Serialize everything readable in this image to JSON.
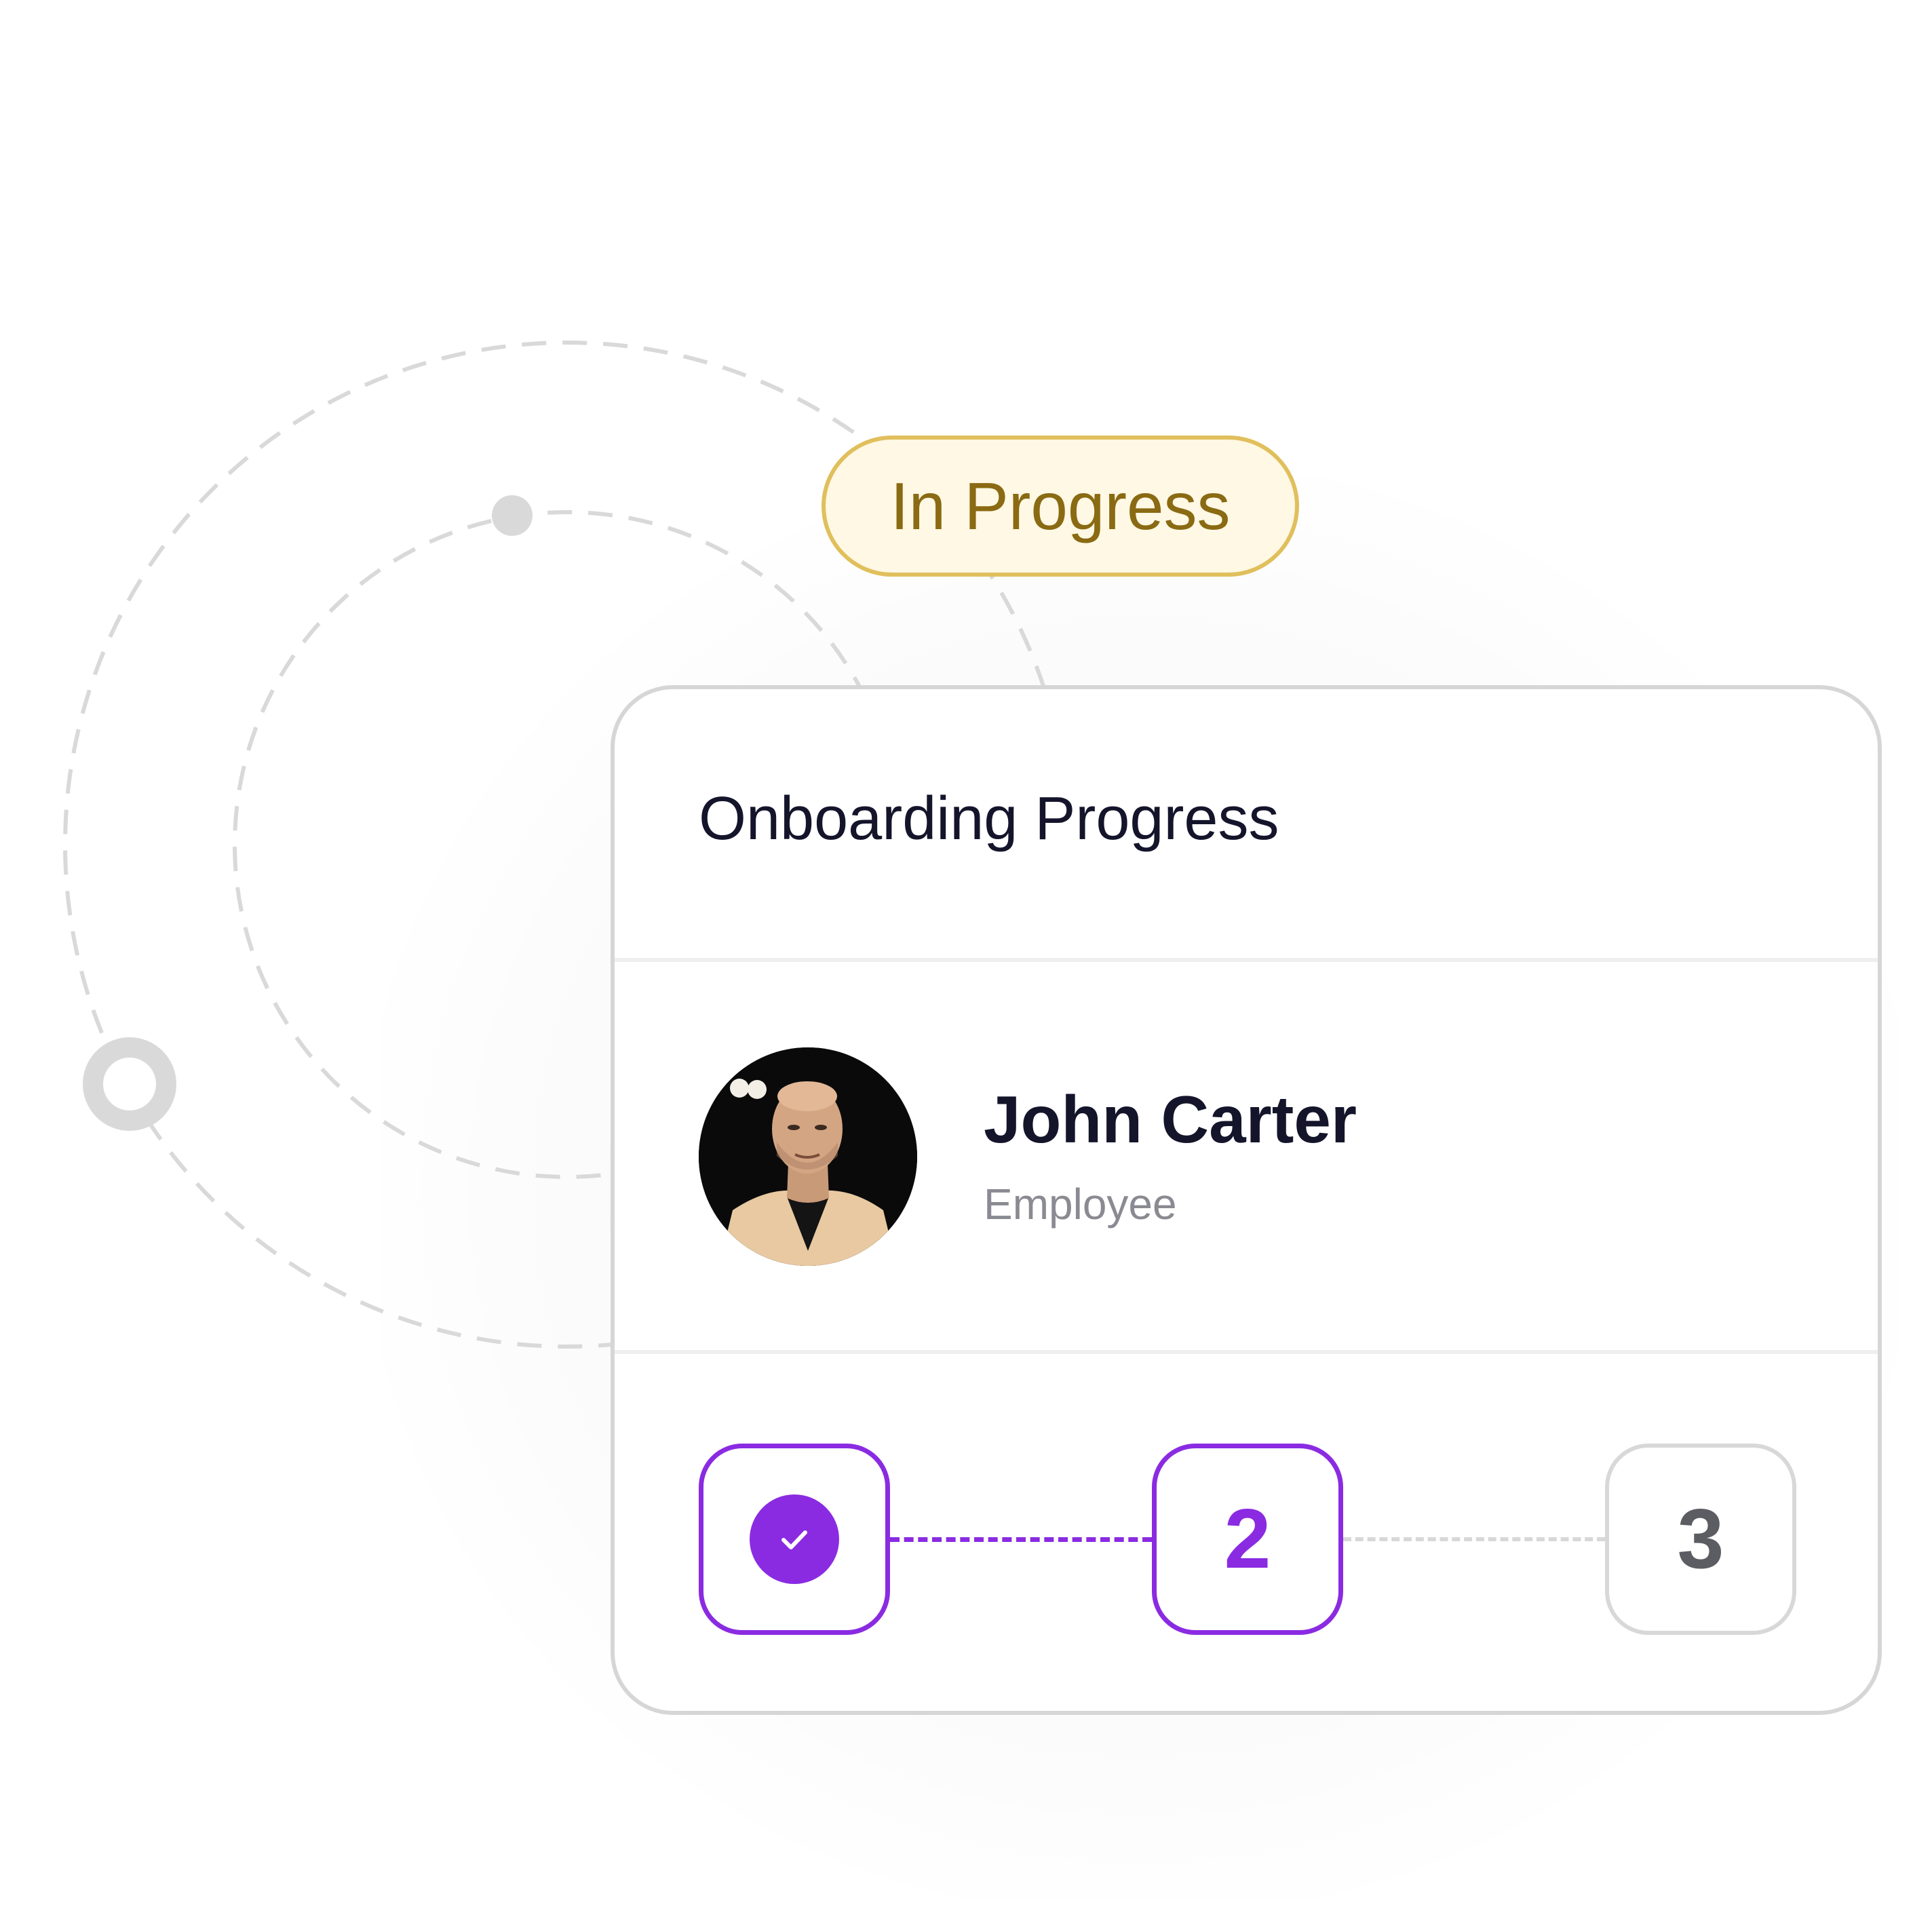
{
  "status_badge": {
    "label": "In Progress",
    "colors": {
      "border": "#e0bf5c",
      "background": "#fef8e4",
      "text": "#8a6a12"
    }
  },
  "card": {
    "title": "Onboarding Progress",
    "employee": {
      "name": "John Carter",
      "role": "Employee",
      "avatar": "employee-photo"
    },
    "steps": [
      {
        "state": "completed",
        "icon": "check-icon",
        "label": ""
      },
      {
        "state": "current",
        "label": "2"
      },
      {
        "state": "upcoming",
        "label": "3"
      }
    ],
    "colors": {
      "accent": "#8a2be2",
      "inactive": "#d8d8d8"
    }
  }
}
